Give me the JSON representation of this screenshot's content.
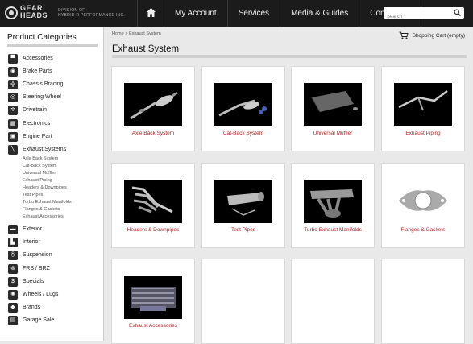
{
  "logo": {
    "line1": "GEAR",
    "line2": "HEADS",
    "division_line1": "DIVISION OF",
    "division_line2": "HYBRID R PERFORMANCE INC."
  },
  "nav": {
    "items": [
      "My Account",
      "Services",
      "Media & Guides",
      "Contact Us"
    ]
  },
  "search": {
    "placeholder": "Search"
  },
  "sidebar": {
    "title": "Product Categories",
    "categories": [
      "Accessories",
      "Brake Parts",
      "Chassis Bracing",
      "Steering Wheel",
      "Drivetrain",
      "Electronics",
      "Engine Part",
      "Exhaust Systems",
      "Exterior",
      "Interior",
      "Suspension",
      "FRS / BRZ",
      "Specials",
      "Wheels / Lugs",
      "Brands",
      "Garage Sale"
    ],
    "subcategories": [
      "Axle Back System",
      "Cat-Back System",
      "Universal Muffler",
      "Exhaust Piping",
      "Headers & Downpipes",
      "Test Pipes",
      "Turbo Exhaust Manifolds",
      "Flanges & Gaskets",
      "Exhaust Accessories"
    ]
  },
  "breadcrumb": "Home > Exhaust System",
  "cart": "Shopping Cart (empty)",
  "page_title": "Exhaust System",
  "products": [
    "Axle Back System",
    "Cat-Back System",
    "Universal Muffler",
    "Exhaust Piping",
    "Headers & Downpipes",
    "Test Pipes",
    "Turbo Exhaust Manifolds",
    "Flanges & Gaskets",
    "Exhaust Accessories"
  ]
}
